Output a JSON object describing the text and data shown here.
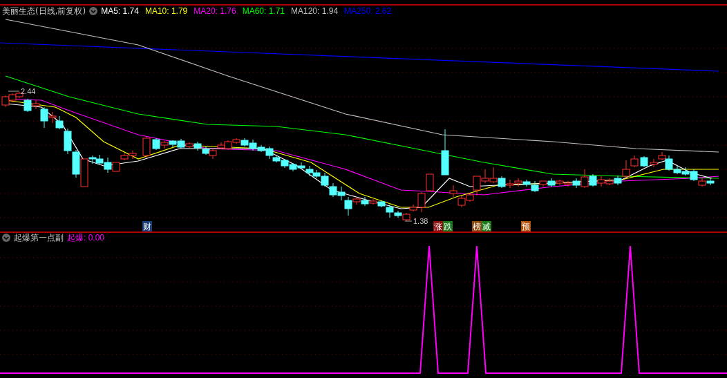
{
  "main_panel": {
    "title": "美丽生态(日线,前复权)",
    "legend": [
      {
        "label": "MA5: 1.74",
        "color": "#ffffff"
      },
      {
        "label": "MA10: 1.79",
        "color": "#ffff00"
      },
      {
        "label": "MA20: 1.76",
        "color": "#ff00ff"
      },
      {
        "label": "MA60: 1.71",
        "color": "#00ff00"
      },
      {
        "label": "MA120: 1.94",
        "color": "#c0c0c0"
      },
      {
        "label": "MA250: 2.62",
        "color": "#0000ff"
      }
    ],
    "price_marks": [
      {
        "text": "2.44"
      },
      {
        "text": "1.38"
      }
    ],
    "event_tags": [
      {
        "label": "财",
        "color": "#1c3f7a"
      },
      {
        "label": "涨",
        "color": "#8b1010"
      },
      {
        "label": "跌",
        "color": "#1a7a1a"
      },
      {
        "label": "榜",
        "color": "#8a4a10"
      },
      {
        "label": "减",
        "color": "#1a7a1a"
      },
      {
        "label": "预",
        "color": "#b0500a"
      }
    ]
  },
  "indicator_panel": {
    "title": "起爆第一点副",
    "reading": "起爆: 0.00"
  }
}
